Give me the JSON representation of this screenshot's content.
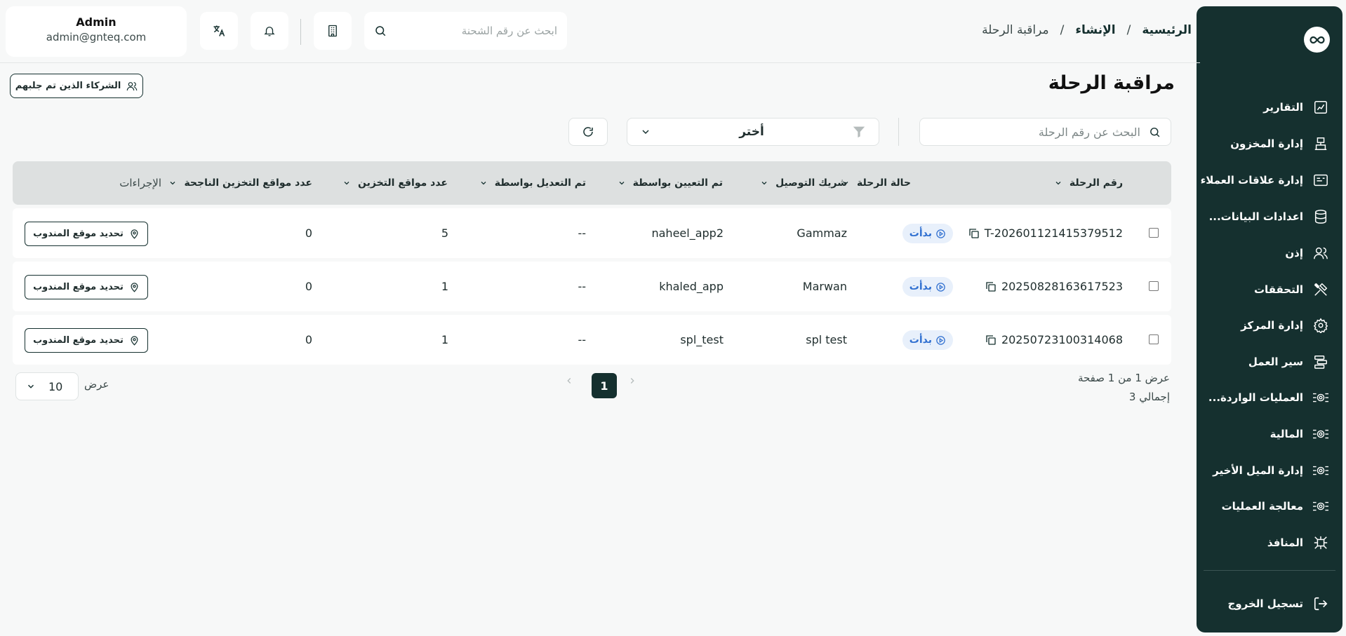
{
  "header": {
    "breadcrumb": [
      "الرئيسية",
      "/",
      "الإنشاء",
      "/",
      "مراقبة الرحلة"
    ],
    "search_placeholder": "ابحث عن رقم الشحنة",
    "user": {
      "name": "Admin",
      "email": "admin@gnteq.com"
    }
  },
  "sidebar": {
    "items": [
      {
        "label": "التقارير",
        "icon": "chart-icon"
      },
      {
        "label": "إدارة المخزون",
        "icon": "inventory-icon"
      },
      {
        "label": "إدارة علاقات العملاء",
        "icon": "crm-icon"
      },
      {
        "label": "اعدادات البيانات...",
        "icon": "database-icon"
      },
      {
        "label": "إذن",
        "icon": "users-icon"
      },
      {
        "label": "التحققات",
        "icon": "tools-icon"
      },
      {
        "label": "إدارة المركز",
        "icon": "settings-icon"
      },
      {
        "label": "سير العمل",
        "icon": "workflow-icon"
      },
      {
        "label": "العمليات الواردة...",
        "icon": "gear-network-icon"
      },
      {
        "label": "المالية",
        "icon": "gear-network-icon"
      },
      {
        "label": "إدارة الميل الأخير",
        "icon": "gear-network-icon"
      },
      {
        "label": "معالجة العمليات",
        "icon": "gear-network-icon"
      },
      {
        "label": "المنافذ",
        "icon": "network-icon"
      }
    ],
    "logout": "تسجيل الخروج"
  },
  "page": {
    "title": "مراقبة الرحلة",
    "partners_button": "الشركاء الذين تم جلبهم",
    "trip_search_placeholder": "البحث عن رقم الرحلة",
    "filter_select_value": "أختر"
  },
  "table": {
    "columns": [
      "رقم الرحلة",
      "حالة الرحلة",
      "شريك التوصيل",
      "تم التعيين بواسطة",
      "تم التعديل بواسطة",
      "عدد مواقع التخزين",
      "عدد مواقع التخزين الناجحة",
      "الإجراءات"
    ],
    "action_label": "تحديد موقع المندوب",
    "rows": [
      {
        "trip_no": "T-202601121415379512",
        "status": "بدأت",
        "partner": "Gammaz",
        "assigned_by": "naheel_app2",
        "modified_by": "--",
        "storage_count": "5",
        "storage_success": "0"
      },
      {
        "trip_no": "20250828163617523",
        "status": "بدأت",
        "partner": "Marwan",
        "assigned_by": "khaled_app",
        "modified_by": "--",
        "storage_count": "1",
        "storage_success": "0"
      },
      {
        "trip_no": "20250723100314068",
        "status": "بدأت",
        "partner": "spl test",
        "assigned_by": "spl_test",
        "modified_by": "--",
        "storage_count": "1",
        "storage_success": "0"
      }
    ]
  },
  "pagination": {
    "showing": "عرض 1 من 1 صفحة",
    "total": "إجمالي 3",
    "current_page": "1",
    "per_page_label": "عرض",
    "per_page_value": "10"
  },
  "colors": {
    "primary": "#15302f",
    "status_bg": "#e8f0fb",
    "status_text": "#2f6fd0"
  }
}
